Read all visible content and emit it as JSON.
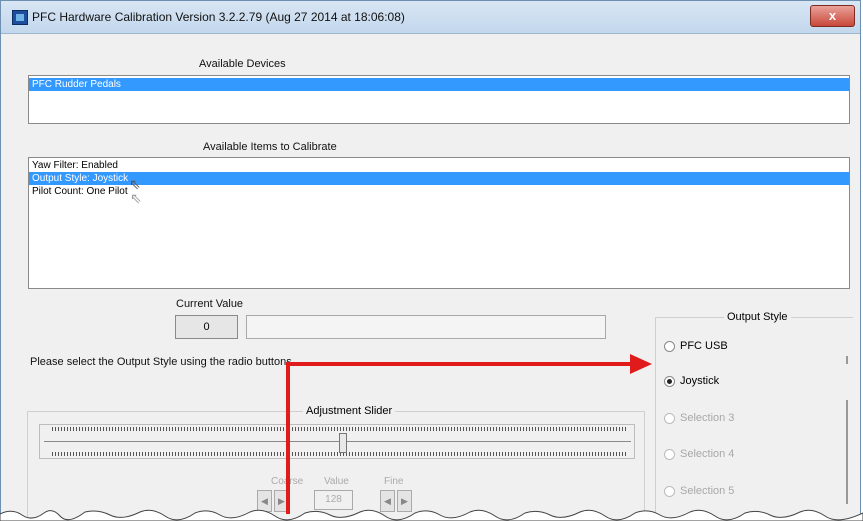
{
  "window": {
    "title": "PFC Hardware Calibration Version 3.2.2.79 (Aug 27 2014 at 18:06:08)",
    "close_label": "x"
  },
  "devices": {
    "label": "Available Devices",
    "items": [
      "PFC Rudder Pedals"
    ],
    "selected": 0
  },
  "calibrate": {
    "label": "Available Items to Calibrate",
    "items": [
      "Yaw Filter: Enabled",
      "Output Style: Joystick",
      "Pilot Count: One Pilot"
    ],
    "selected": 1
  },
  "current_value": {
    "label": "Current Value",
    "value": "0",
    "text": ""
  },
  "instruction": "Please select the Output Style using the radio buttons.",
  "output_style": {
    "title": "Output Style",
    "options": [
      {
        "label": "PFC USB",
        "checked": false,
        "enabled": true
      },
      {
        "label": "Joystick",
        "checked": true,
        "enabled": true
      },
      {
        "label": "Selection 3",
        "checked": false,
        "enabled": false
      },
      {
        "label": "Selection 4",
        "checked": false,
        "enabled": false
      },
      {
        "label": "Selection 5",
        "checked": false,
        "enabled": false
      }
    ]
  },
  "slider": {
    "title": "Adjustment Slider",
    "coarse_label": "Coarse",
    "value_label": "Value",
    "fine_label": "Fine",
    "value": "128",
    "level": 0.5
  },
  "colors": {
    "selection": "#3399ff",
    "annotation_arrow": "#e11b1b"
  },
  "icons": {
    "app": "pfc-app-icon",
    "pointer": "mouse-pointer-icon"
  }
}
